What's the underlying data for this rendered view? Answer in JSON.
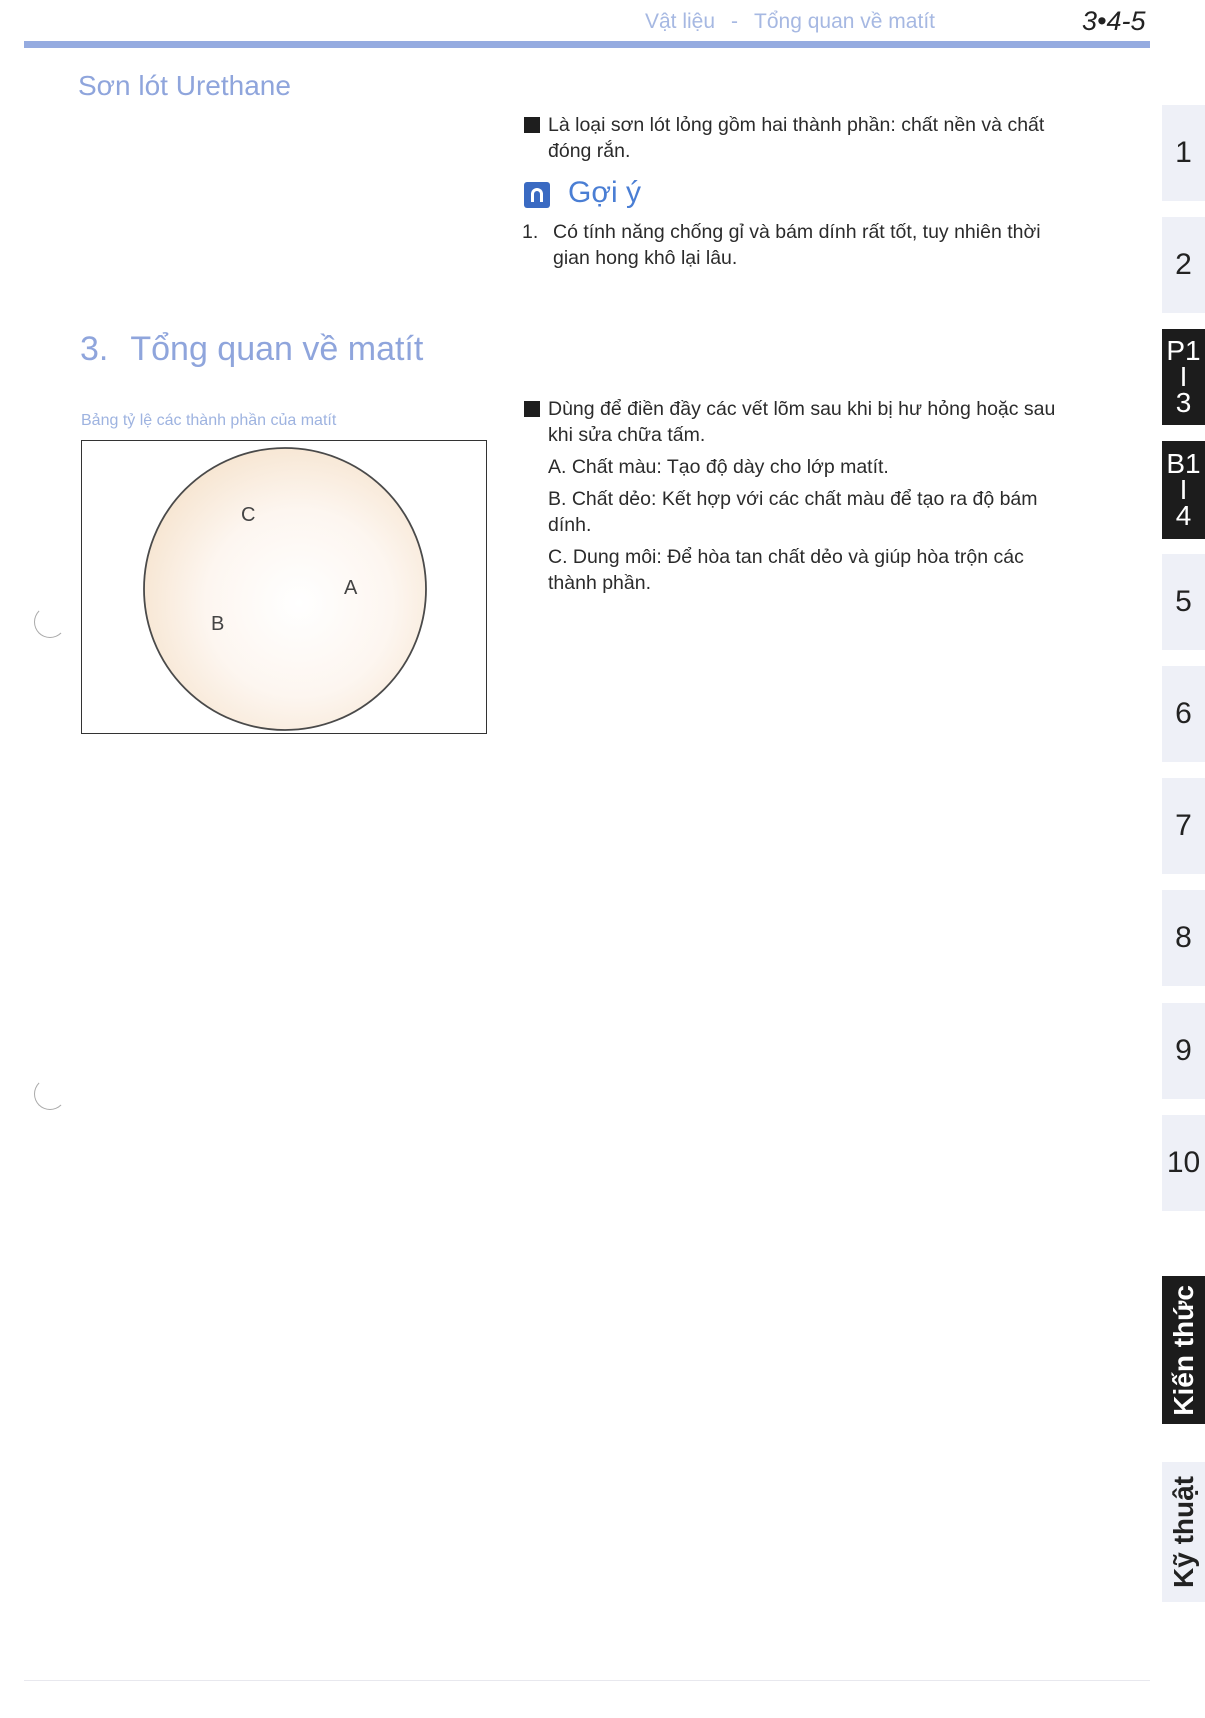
{
  "header": {
    "section": "Vật liệu",
    "separator": "-",
    "topic": "Tổng quan về matít",
    "page_number": "3•4-5"
  },
  "urethane": {
    "title": "Sơn lót Urethane",
    "bullet_line1": "Là loại sơn lót lỏng gồm hai thành phần: chất nền và chất",
    "bullet_line2": "đóng rắn.",
    "tip_label": "Gợi ý",
    "tip_num": "1.",
    "tip_line1": "Có tính năng chống gỉ và bám dính rất tốt, tuy nhiên thời",
    "tip_line2": "gian hong khô lại lâu."
  },
  "matit": {
    "number": "3.",
    "title": "Tổng quan về matít",
    "caption": "Bảng tỷ lệ các thành phần của matít",
    "pie_labels": {
      "a": "A",
      "b": "B",
      "c": "C"
    },
    "intro_line1": "Dùng để điền đầy các vết lõm sau khi bị hư hỏng hoặc sau",
    "intro_line2": "khi sửa chữa tấm.",
    "item_a": "A. Chất màu: Tạo độ dày cho lớp matít.",
    "item_b_line1": "B. Chất dẻo: Kết hợp với các chất màu để tạo ra độ bám",
    "item_b_line2": "dính.",
    "item_c_line1": "C. Dung môi: Để hòa tan chất dẻo và giúp hòa trộn các",
    "item_c_line2": "thành phần."
  },
  "side_tabs": {
    "t1": "1",
    "t2": "2",
    "t3_top": "P1",
    "t3_mid": "I",
    "t3_bot": "3",
    "t4_top": "B1",
    "t4_mid": "I",
    "t4_bot": "4",
    "t5": "5",
    "t6": "6",
    "t7": "7",
    "t8": "8",
    "t9": "9",
    "t10": "10",
    "kien_thuc": "Kiến thức",
    "ky_thuat": "Kỹ thuật"
  },
  "colors": {
    "accent_blue": "#95abe0",
    "heading_blue": "#8fa5dc",
    "tab_dark": "#1c1c1c"
  }
}
